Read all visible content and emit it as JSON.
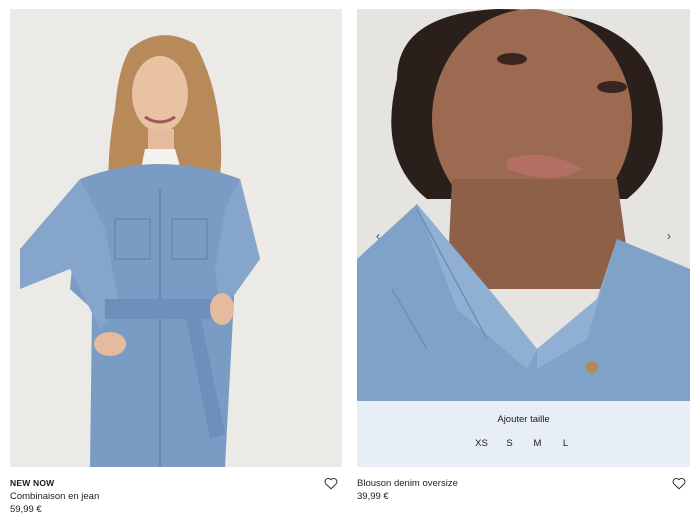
{
  "products": [
    {
      "badge": "NEW NOW",
      "name": "Combinaison en jean",
      "price": "59,99 €",
      "icon": "heart-icon"
    },
    {
      "badge": "",
      "name": "Blouson denim oversize",
      "price": "39,99 €",
      "icon": "heart-icon",
      "carousel": {
        "prev_icon": "‹",
        "next_icon": "›"
      },
      "size_panel": {
        "title": "Ajouter taille",
        "sizes": [
          "XS",
          "S",
          "M",
          "L"
        ]
      }
    }
  ],
  "colors": {
    "denim": "#7a9cc4",
    "background": "#ececea",
    "text": "#1a1a1a"
  }
}
